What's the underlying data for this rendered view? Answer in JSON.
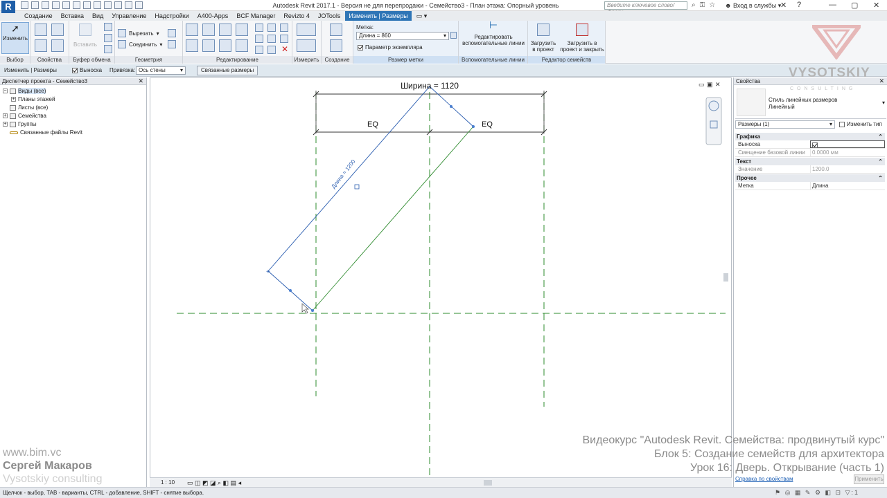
{
  "titlebar": {
    "logo": "R",
    "title": "Autodesk Revit 2017.1 - Версия не для перепродажи -    Семейство3 - План этажа: Опорный уровень",
    "search_placeholder": "Введите ключевое слово/фразу",
    "login": "Вход в службы"
  },
  "tabs": [
    "Создание",
    "Вставка",
    "Вид",
    "Управление",
    "Надстройки",
    "A400-Apps",
    "BCF Manager",
    "Revizto 4",
    "JOTools",
    "Изменить | Размеры"
  ],
  "ribbon": {
    "modify_label": "Изменить",
    "properties_label": "Свойства",
    "paste_label": "Вставить",
    "cut_label": "Вырезать",
    "join_label": "Соединить",
    "tag_caption": "Метка:",
    "tag_value": "Длина = 860",
    "instance_param": "Параметр экземпляра",
    "edit_ref_lines": "Редактировать вспомогательные линии",
    "load_into_project": "Загрузить в проект",
    "load_and_close": "Загрузить в проект и закрыть",
    "panels": {
      "select": "Выбор",
      "properties": "Свойства",
      "clipboard": "Буфер обмена",
      "geometry": "Геометрия",
      "modify": "Редактирование",
      "measure": "Измерить",
      "create": "Создание",
      "label_dim": "Размер метки",
      "ref_lines": "Вспомогательные линии",
      "family_editor": "Редактор семейств"
    }
  },
  "optbar": {
    "context": "Изменить | Размеры",
    "leader": "Выноска",
    "snap_label": "Привязка:",
    "snap_value": "Ось стены",
    "linked_dims": "Связанные размеры"
  },
  "browser": {
    "title": "Диспетчер проекта - Семейство3",
    "items": [
      {
        "label": "Виды (все)",
        "level": 0
      },
      {
        "label": "Планы этажей",
        "level": 1
      },
      {
        "label": "Листы (все)",
        "level": 0
      },
      {
        "label": "Семейства",
        "level": 0
      },
      {
        "label": "Группы",
        "level": 0
      },
      {
        "label": "Связанные файлы Revit",
        "level": 0
      }
    ]
  },
  "watermark": {
    "site": "www.bim.vc",
    "author": "Сергей Макаров",
    "company": "Vysotskiy consulting"
  },
  "canvas": {
    "width_dim": "Ширина = 1120",
    "eq_left": "EQ",
    "eq_right": "EQ",
    "length_dim": "Длина = 1200",
    "scale": "1 : 10"
  },
  "properties": {
    "title": "Свойства",
    "type_name_line1": "Стиль линейных размеров",
    "type_name_line2": "Линейный",
    "instance_filter": "Размеры (1)",
    "edit_type": "Изменить тип",
    "groups": [
      {
        "name": "Графика",
        "rows": [
          {
            "key": "Выноска",
            "value": "checkbox"
          },
          {
            "key": "Смещение базовой линии",
            "value": "0.0000 мм"
          }
        ]
      },
      {
        "name": "Текст",
        "rows": [
          {
            "key": "Значение",
            "value": "1200.0"
          }
        ]
      },
      {
        "name": "Прочее",
        "rows": [
          {
            "key": "Метка",
            "value": "Длина"
          }
        ]
      }
    ],
    "help_link": "Справка по свойствам",
    "apply": "Применить"
  },
  "course": {
    "line1": "Видеокурс \"Autodesk Revit. Семейства: продвинутый курс\"",
    "line2": "Блок 5: Создание семейств для архитектора",
    "line3": "Урок 16: Дверь. Открывание (часть 1)"
  },
  "logo": {
    "word": "VYSOTSKIY",
    "sub": "CONSULTING"
  },
  "statusbar": {
    "message": "Щелчок - выбор, TAB - варианты, CTRL - добавление, SHIFT - снятие выбора."
  }
}
